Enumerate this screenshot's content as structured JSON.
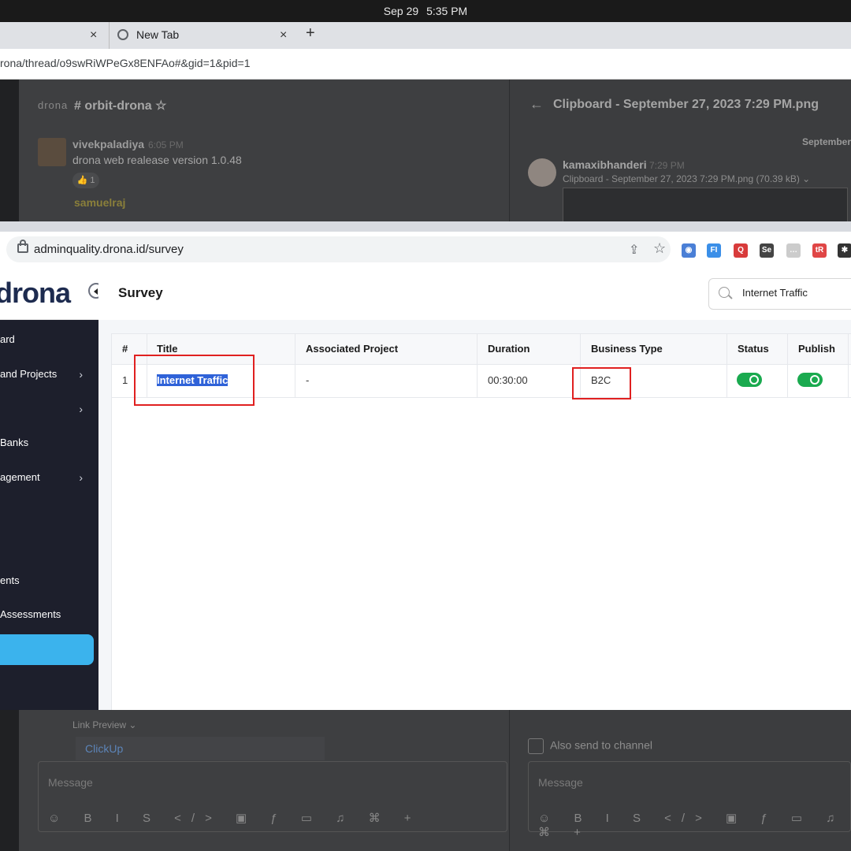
{
  "system": {
    "date": "Sep 29",
    "time": "5:35 PM"
  },
  "bg_browser": {
    "tab_close": "×",
    "new_tab_label": "New Tab",
    "new_tab_plus": "+",
    "url": "rona/thread/o9swRiWPeGx8ENFAo#&gid=1&pid=1"
  },
  "chat": {
    "brand": "drona",
    "channel": "# orbit-drona ☆",
    "user1": "vivekpaladiya",
    "time1": "6:05 PM",
    "msg1": "drona web realease version 1.0.48",
    "reaction": "👍 1",
    "user2": "samuelraj",
    "thread_title": "Clipboard - September 27, 2023 7:29 PM.png",
    "back": "←",
    "date_sep": "September",
    "user3": "kamaxibhanderi",
    "time3": "7:29 PM",
    "file3": "Clipboard - September 27, 2023 7:29 PM.png (70.39 kB)  ⌄",
    "link_preview": "Link Preview ⌄",
    "clickup": "ClickUp",
    "message_placeholder": "Message",
    "also_send": "Also send to channel",
    "toolbar_glyphs": "☺ B I S </> ▣ ƒ ▭ ♫ ⌘ +"
  },
  "fg_browser": {
    "url": "adminquality.drona.id/survey",
    "extensions": [
      {
        "label": "◉",
        "color": "#4a7fd6"
      },
      {
        "label": "FI",
        "color": "#3b8fe8"
      },
      {
        "label": "Q",
        "color": "#d83b3b"
      },
      {
        "label": "Se",
        "color": "#444444"
      },
      {
        "label": "…",
        "color": "#cccccc"
      },
      {
        "label": "tR",
        "color": "#e04646"
      },
      {
        "label": "✱",
        "color": "#333333"
      }
    ]
  },
  "app": {
    "logo": "drona",
    "sidebar": {
      "items": [
        {
          "label": "ard",
          "chevron": ""
        },
        {
          "label": "and Projects",
          "chevron": "›"
        },
        {
          "label": "",
          "chevron": "›"
        },
        {
          "label": "Banks",
          "chevron": ""
        },
        {
          "label": "agement",
          "chevron": "›"
        },
        {
          "label": "ents",
          "chevron": ""
        },
        {
          "label": "Assessments",
          "chevron": ""
        }
      ]
    },
    "page_title": "Survey",
    "search_value": "Internet Traffic",
    "table": {
      "headers": [
        "#",
        "Title",
        "Associated Project",
        "Duration",
        "Business Type",
        "Status",
        "Publish"
      ],
      "rows": [
        {
          "num": "1",
          "title": "Internet Traffic",
          "project": "-",
          "duration": "00:30:00",
          "business_type": "B2C",
          "status": true,
          "publish": true
        }
      ]
    }
  }
}
